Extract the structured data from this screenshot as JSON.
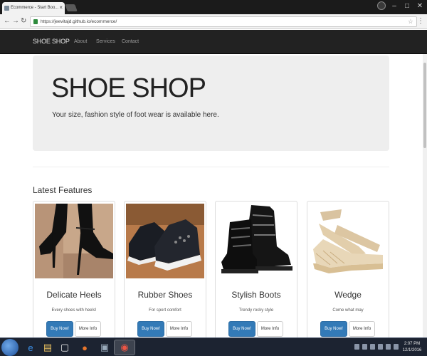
{
  "browser": {
    "tab_title": "Ecommerce - Start Boo...",
    "url": "https://jeevitajd.github.io/ecommerce/",
    "close_tab": "×"
  },
  "navbar": {
    "brand": "SHOE SHOP",
    "links": [
      "About",
      "Services",
      "Contact"
    ]
  },
  "jumbotron": {
    "title": "SHOE SHOP",
    "subtitle": "Your size, fashion style of foot wear is available here."
  },
  "features": {
    "title": "Latest Features",
    "cards": [
      {
        "name": "Delicate Heels",
        "description": "Every shoes with heels!",
        "buy_label": "Buy Now!",
        "more_label": "More Info"
      },
      {
        "name": "Rubber Shoes",
        "description": "For sport comfort",
        "buy_label": "Buy Now!",
        "more_label": "More Info"
      },
      {
        "name": "Stylish Boots",
        "description": "Trendy rocky style",
        "buy_label": "Buy Now!",
        "more_label": "More Info"
      },
      {
        "name": "Wedge",
        "description": "Come what may",
        "buy_label": "Buy Now!",
        "more_label": "More Info"
      }
    ]
  },
  "taskbar": {
    "time": "2:07 PM",
    "date": "12/1/2016"
  },
  "colors": {
    "navbar_bg": "#222222",
    "jumbotron_bg": "#eeeeee",
    "primary_button": "#337ab7",
    "taskbar_bg": "#1c2331"
  }
}
